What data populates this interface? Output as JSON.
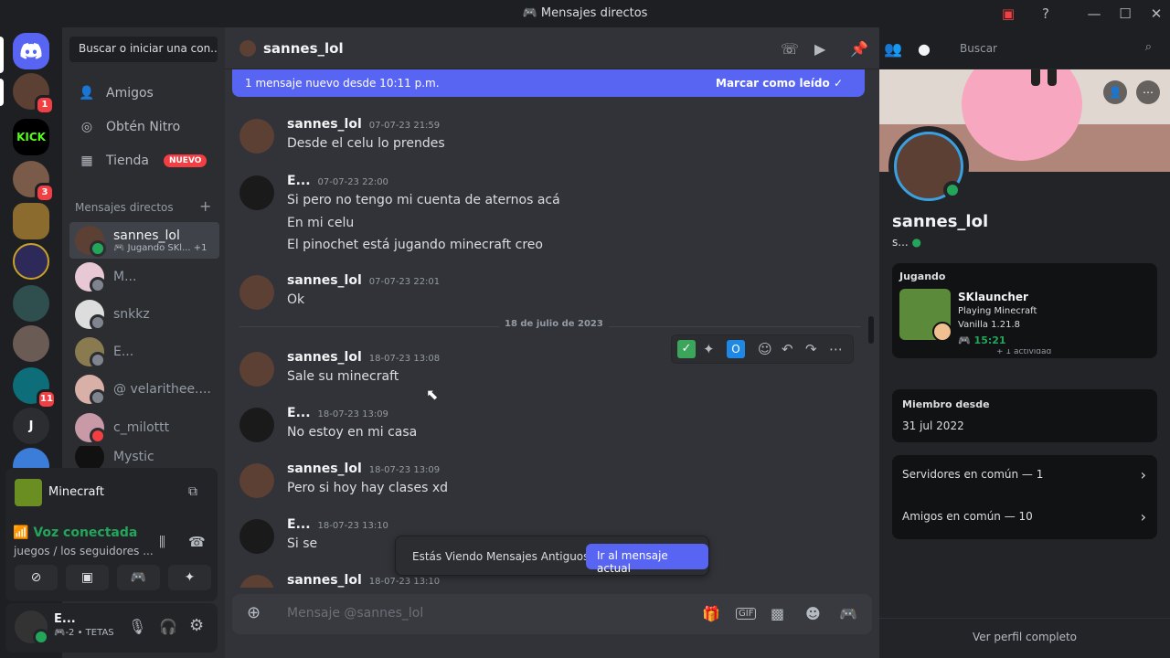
{
  "window": {
    "title": "Mensajes directos"
  },
  "servers": [
    {
      "name": "discord-home",
      "label": ""
    },
    {
      "name": "server-avatar-1",
      "badge": "1"
    },
    {
      "name": "kick",
      "label": "KICK"
    },
    {
      "name": "server-avatar-2",
      "badge": "3"
    },
    {
      "name": "minecraft-server",
      "label": ""
    },
    {
      "name": "server-avatar-3",
      "label": ""
    },
    {
      "name": "server-avatar-4",
      "label": ""
    },
    {
      "name": "server-avatar-5",
      "label": ""
    },
    {
      "name": "server-avatar-6",
      "badge": "11"
    },
    {
      "name": "server-j",
      "label": "J"
    }
  ],
  "sidebar": {
    "search_label": "Buscar o iniciar una con...",
    "nav": [
      {
        "label": "Amigos",
        "icon": "friends-icon"
      },
      {
        "label": "Obtén Nitro",
        "icon": "nitro-icon"
      },
      {
        "label": "Tienda",
        "icon": "shop-icon",
        "badge": "NUEVO"
      }
    ],
    "dm_header": "Mensajes directos",
    "dms": [
      {
        "name": "sannes_lol",
        "sub": "Jugando SKl...",
        "extra": "+1",
        "active": true,
        "status": "#23a55a"
      },
      {
        "name": "M...",
        "sub": "",
        "status": "#80848e"
      },
      {
        "name": "snkkz",
        "sub": "",
        "status": "#80848e"
      },
      {
        "name": "E...",
        "sub": "",
        "status": "#80848e"
      },
      {
        "name": "@ velarithee....",
        "sub": "",
        "status": "#80848e"
      },
      {
        "name": "c_milottt",
        "sub": "",
        "status": "#f23f43"
      },
      {
        "name": "Mystic",
        "sub": "",
        "status": "#80848e"
      }
    ]
  },
  "voice_panel": {
    "game": "Minecraft",
    "status": "Voz conectada",
    "channel": "juegos / los seguidores ..."
  },
  "user_panel": {
    "name": "E...",
    "sub": "-2 • TETAS"
  },
  "chat": {
    "title": "sannes_lol",
    "search_placeholder": "Buscar",
    "new_banner": "1 mensaje nuevo desde 10:11 p.m.",
    "mark_read": "Marcar como leído",
    "date_divider": "18 de julio de 2023",
    "messages": [
      {
        "author": "sannes_lol",
        "time": "07-07-23 21:59",
        "lines": [
          "Desde el celu lo prendes"
        ]
      },
      {
        "author": "E...",
        "time": "07-07-23 22:00",
        "lines": [
          "Si pero no tengo mi cuenta de aternos acá",
          "En mi celu",
          "El pinochet está jugando minecraft creo"
        ]
      },
      {
        "author": "sannes_lol",
        "time": "07-07-23 22:01",
        "lines": [
          "Ok"
        ]
      },
      {
        "author": "sannes_lol",
        "time": "18-07-23 13:08",
        "lines": [
          "Sale su minecraft"
        ]
      },
      {
        "author": "E...",
        "time": "18-07-23 13:09",
        "lines": [
          "No estoy en mi casa"
        ]
      },
      {
        "author": "sannes_lol",
        "time": "18-07-23 13:09",
        "lines": [
          "Pero si hoy hay clases xd"
        ]
      },
      {
        "author": "E...",
        "time": "18-07-23 13:10",
        "lines": [
          "Si se"
        ]
      },
      {
        "author": "sannes_lol",
        "time": "18-07-23 13:10",
        "lines": [
          ""
        ]
      }
    ],
    "old_messages_text": "Estás Viendo Mensajes Antiguos",
    "jump_button": "Ir al mensaje actual",
    "composer_placeholder": "Mensaje @sannes_lol"
  },
  "profile": {
    "name": "sannes_lol",
    "tag": "s...",
    "activity_header": "Jugando",
    "activity_name": "SKlauncher",
    "activity_detail": "Playing Minecraft",
    "activity_version": "Vanilla 1.21.8",
    "activity_time": "15:21",
    "activity_more": "+ 1 actividad",
    "member_since_label": "Miembro desde",
    "member_since": "31 jul 2022",
    "servers_common": "Servidores en común — 1",
    "friends_common": "Amigos en común — 10",
    "full_profile": "Ver perfil completo"
  }
}
